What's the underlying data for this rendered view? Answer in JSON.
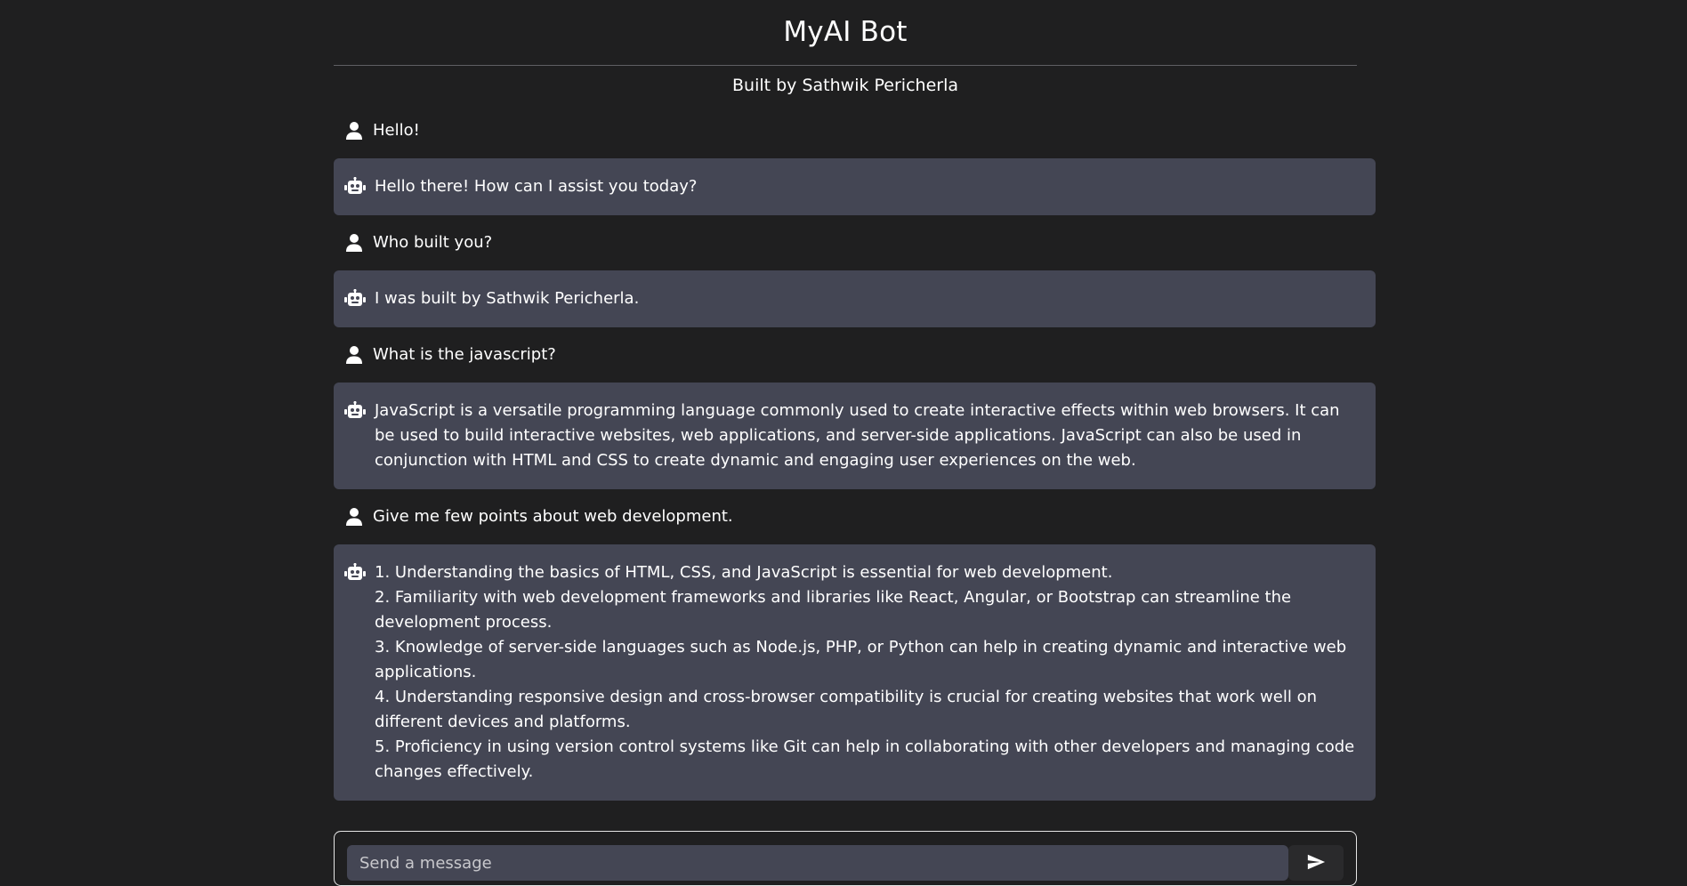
{
  "header": {
    "title": "MyAI Bot",
    "subtitle": "Built by Sathwik Pericherla"
  },
  "messages": [
    {
      "role": "user",
      "icon": "user-icon",
      "text": "Hello!"
    },
    {
      "role": "bot",
      "icon": "robot-icon",
      "text": "Hello there! How can I assist you today?"
    },
    {
      "role": "user",
      "icon": "user-icon",
      "text": "Who built you?"
    },
    {
      "role": "bot",
      "icon": "robot-icon",
      "text": "I was built by Sathwik Pericherla."
    },
    {
      "role": "user",
      "icon": "user-icon",
      "text": "What is the javascript?"
    },
    {
      "role": "bot",
      "icon": "robot-icon",
      "text": "JavaScript is a versatile programming language commonly used to create interactive effects within web browsers. It can be used to build interactive websites, web applications, and server-side applications. JavaScript can also be used in conjunction with HTML and CSS to create dynamic and engaging user experiences on the web."
    },
    {
      "role": "user",
      "icon": "user-icon",
      "text": "Give me few points about web development."
    },
    {
      "role": "bot",
      "icon": "robot-icon",
      "text": "1. Understanding the basics of HTML, CSS, and JavaScript is essential for web development.\n2. Familiarity with web development frameworks and libraries like React, Angular, or Bootstrap can streamline the development process.\n3. Knowledge of server-side languages such as Node.js, PHP, or Python can help in creating dynamic and interactive web applications.\n4. Understanding responsive design and cross-browser compatibility is crucial for creating websites that work well on different devices and platforms.\n5. Proficiency in using version control systems like Git can help in collaborating with other developers and managing code changes effectively."
    }
  ],
  "composer": {
    "placeholder": "Send a message",
    "send_icon": "send-icon"
  },
  "colors": {
    "background": "#1f1f20",
    "bot_bubble": "#444654",
    "text": "#ffffff"
  }
}
